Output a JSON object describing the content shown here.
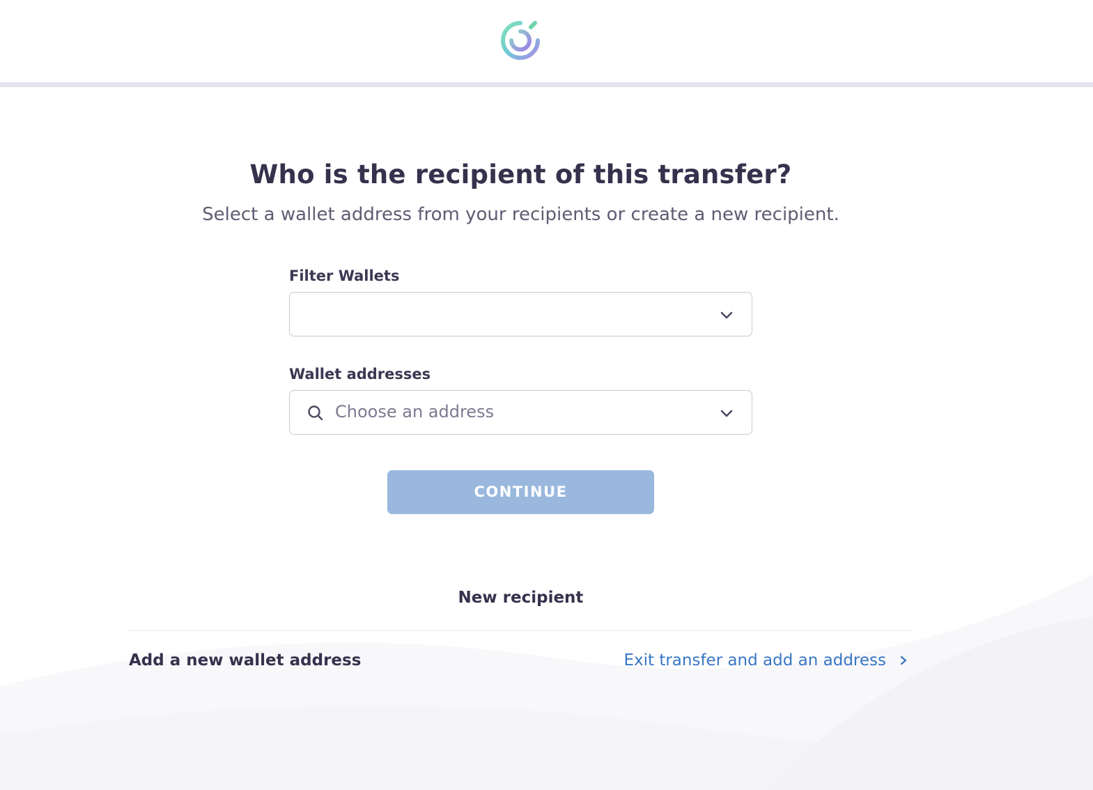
{
  "header": {
    "logo_icon": "circle-logo-icon"
  },
  "main": {
    "title": "Who is the recipient of this transfer?",
    "subtitle": "Select a wallet address from your recipients or create a new recipient.",
    "filter_wallets": {
      "label": "Filter Wallets",
      "value": ""
    },
    "wallet_addresses": {
      "label": "Wallet addresses",
      "placeholder": "Choose an address"
    },
    "continue_label": "CONTINUE"
  },
  "new_recipient": {
    "title": "New recipient",
    "row_label": "Add a new wallet address",
    "link_label": "Exit transfer and add an address"
  },
  "colors": {
    "accent": "#3876c4",
    "button_disabled": "#9ab8de",
    "text_primary": "#34324c"
  }
}
